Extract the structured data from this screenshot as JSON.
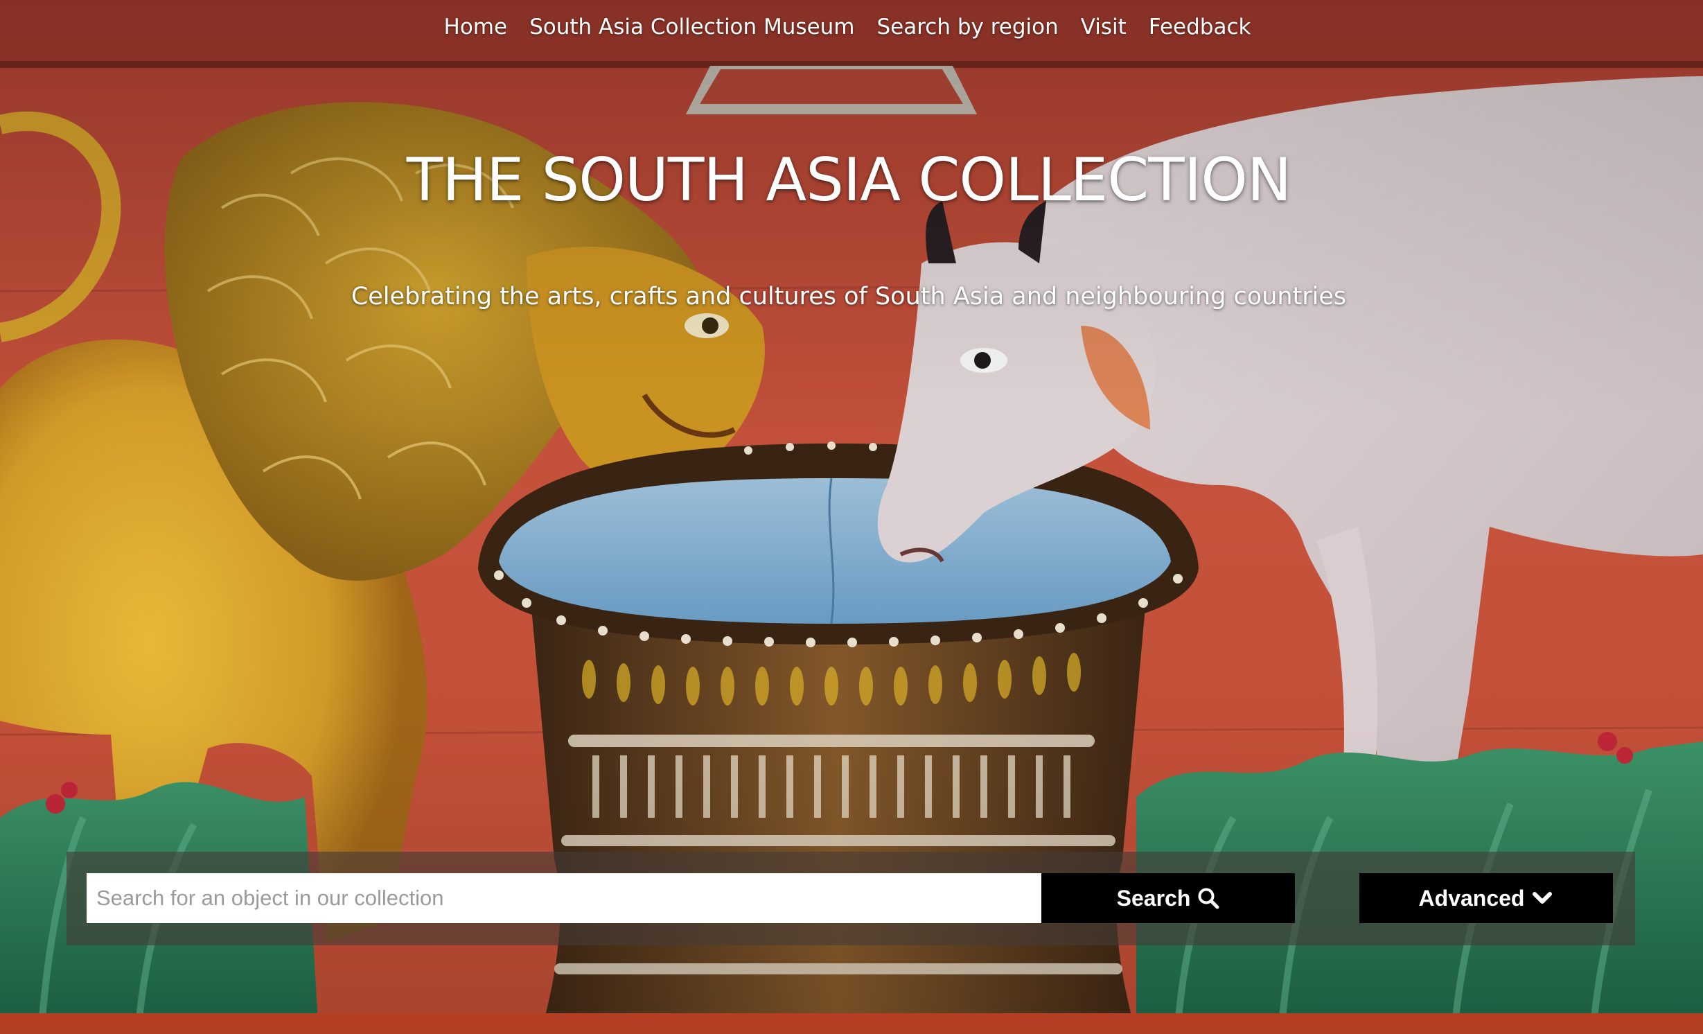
{
  "nav": {
    "items": [
      {
        "label": "Home"
      },
      {
        "label": "South Asia Collection Museum"
      },
      {
        "label": "Search by region"
      },
      {
        "label": "Visit"
      },
      {
        "label": "Feedback"
      }
    ]
  },
  "hero": {
    "title": "THE SOUTH ASIA COLLECTION",
    "tagline": "Celebrating the arts, crafts and cultures of South Asia and neighbouring countries",
    "background_image": "painted wooden relief of a lion and a cow drinking from a bowl"
  },
  "search": {
    "placeholder": "Search for an object in our collection",
    "value": "",
    "search_label": "Search",
    "search_icon": "magnifier-icon",
    "advanced_label": "Advanced",
    "advanced_icon": "chevron-down-icon"
  },
  "colors": {
    "button_bg": "#000000",
    "button_text": "#ffffff",
    "band_overlay": "rgba(70,60,55,0.62)",
    "hero_red": "#c9563c"
  }
}
